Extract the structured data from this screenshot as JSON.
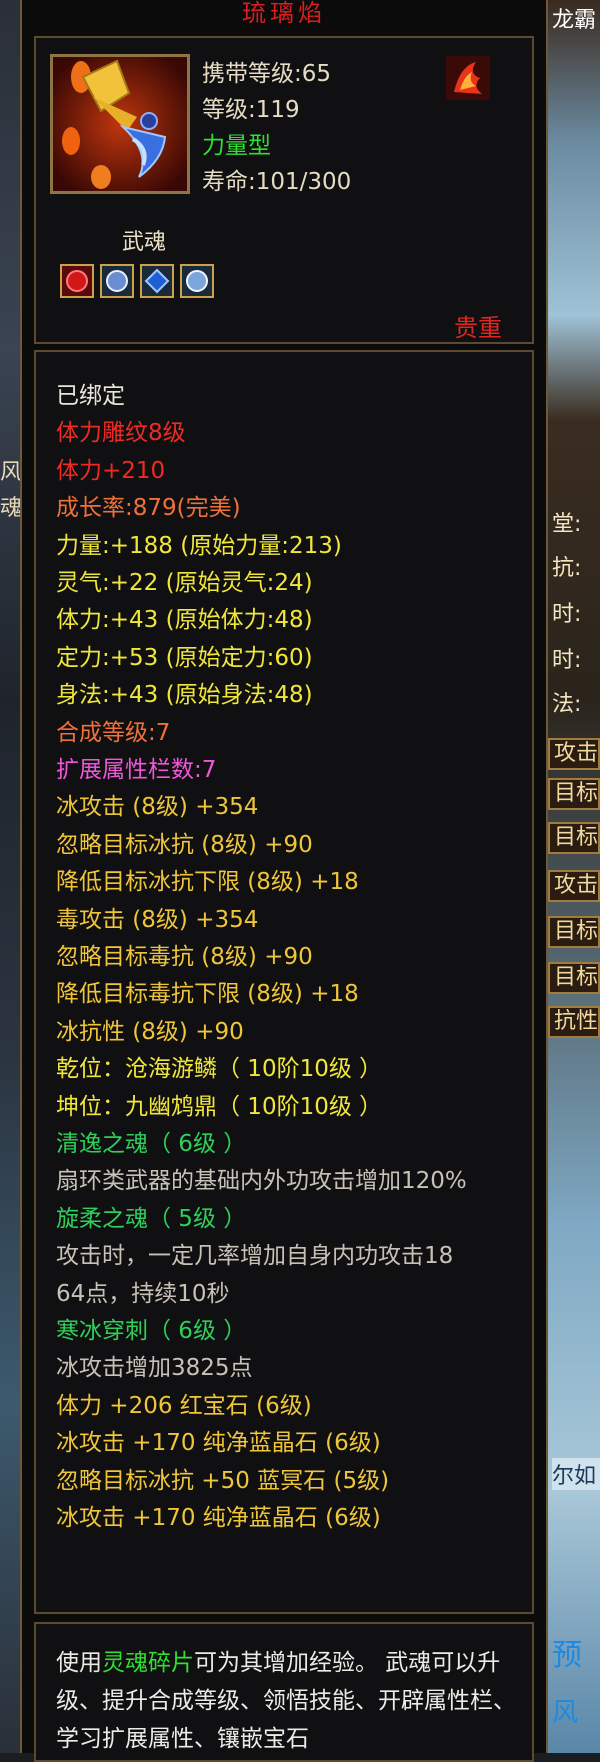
{
  "tooltip": {
    "title": "琉璃焰",
    "carry_level": "携带等级:65",
    "level": "等级:119",
    "type": "力量型",
    "lifespan": "寿命:101/300",
    "category": "武魂",
    "rarity": "贵重",
    "properties": [
      {
        "text": "已绑定",
        "color": "white"
      },
      {
        "text": "体力雕纹8级",
        "color": "red"
      },
      {
        "text": "体力+210",
        "color": "red"
      },
      {
        "text": "成长率:879(完美)",
        "color": "orange"
      },
      {
        "text": "力量:+188 (原始力量:213)",
        "color": "yellow"
      },
      {
        "text": "灵气:+22 (原始灵气:24)",
        "color": "yellow"
      },
      {
        "text": "体力:+43 (原始体力:48)",
        "color": "yellow"
      },
      {
        "text": "定力:+53 (原始定力:60)",
        "color": "yellow"
      },
      {
        "text": "身法:+43 (原始身法:48)",
        "color": "yellow"
      },
      {
        "text": "合成等级:7",
        "color": "orange"
      },
      {
        "text": "扩展属性栏数:7",
        "color": "magenta"
      },
      {
        "text": "冰攻击 (8级) +354",
        "color": "gold"
      },
      {
        "text": "忽略目标冰抗 (8级) +90",
        "color": "gold"
      },
      {
        "text": "降低目标冰抗下限 (8级) +18",
        "color": "gold"
      },
      {
        "text": "毒攻击 (8级) +354",
        "color": "gold"
      },
      {
        "text": "忽略目标毒抗 (8级) +90",
        "color": "gold"
      },
      {
        "text": "降低目标毒抗下限 (8级) +18",
        "color": "gold"
      },
      {
        "text": "冰抗性 (8级) +90",
        "color": "gold"
      },
      {
        "text": "乾位：沧海游鳞（ 10阶10级 ）",
        "color": "yellow"
      },
      {
        "text": "坤位：九幽鸩鼎（ 10阶10级 ）",
        "color": "yellow"
      },
      {
        "text": "清逸之魂（ 6级 ）",
        "color": "green"
      },
      {
        "text": "扇环类武器的基础内外功攻击增加120%",
        "color": "gray"
      },
      {
        "text": "旋柔之魂（ 5级 ）",
        "color": "green"
      },
      {
        "text": "攻击时，一定几率增加自身内功攻击18",
        "color": "gray"
      },
      {
        "text": "64点，持续10秒",
        "color": "gray"
      },
      {
        "text": "寒冰穿刺（ 6级 ）",
        "color": "green"
      },
      {
        "text": "冰攻击增加3825点",
        "color": "gray"
      },
      {
        "text": "体力 +206 红宝石 (6级)",
        "color": "gold"
      },
      {
        "text": "冰攻击 +170 纯净蓝晶石 (6级)",
        "color": "gold"
      },
      {
        "text": "忽略目标冰抗 +50 蓝冥石 (5级)",
        "color": "gold"
      },
      {
        "text": "冰攻击 +170 纯净蓝晶石 (6级)",
        "color": "gold"
      }
    ],
    "description_prefix": "使用",
    "description_highlight": "灵魂碎片",
    "description_rest": "可为其增加经验。 武魂可以升级、提升合成等级、领悟技能、开辟属性栏、学习扩展属性、镶嵌宝石"
  },
  "background": {
    "right_top_label": "龙霸",
    "right_side_labels": [
      "堂:",
      "抗:",
      "时:",
      "时:",
      "法:"
    ],
    "right_buttons": [
      "攻击",
      "目标",
      "目标",
      "攻击",
      "目标",
      "目标",
      "抗性"
    ],
    "right_bottom_labels": [
      "尔如",
      "预",
      "风"
    ],
    "left_labels": [
      "风",
      "魂"
    ]
  },
  "colors": {
    "white": "#e8e4d8",
    "red": "#ef2a23",
    "orange": "#f0703a",
    "yellow": "#f1e73b",
    "magenta": "#ef56d8",
    "gold": "#efc53a",
    "green": "#2fcf5a",
    "gray": "#c8c2b6"
  }
}
